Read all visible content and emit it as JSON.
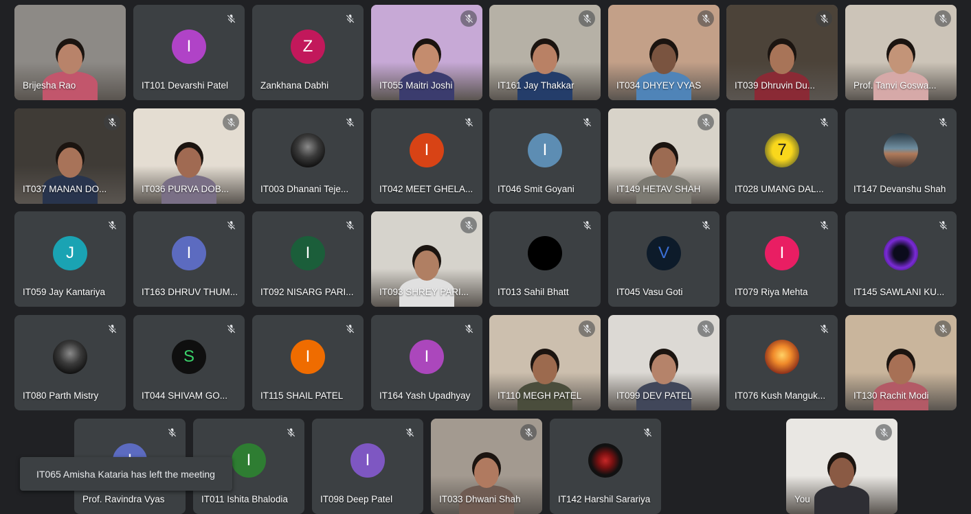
{
  "app": "Google Meet",
  "toast": "IT065 Amisha Kataria has left the meeting",
  "participants": [
    {
      "name": "Brijesha Rao",
      "type": "video",
      "mic_icon": false,
      "bg": "#8d8a86",
      "skin": "#b8836a",
      "shirt": "#c2566c"
    },
    {
      "name": "IT101 Devarshi Patel",
      "type": "avatar",
      "initial": "I",
      "color": "#b043c7"
    },
    {
      "name": "Zankhana Dabhi",
      "type": "avatar",
      "initial": "Z",
      "color": "#c2185b"
    },
    {
      "name": "IT055 Maitri Joshi",
      "type": "video",
      "bg": "#c7a9d6",
      "skin": "#c48c6e",
      "shirt": "#3b3c6e"
    },
    {
      "name": "IT161 Jay Thakkar",
      "type": "video",
      "bg": "#b6b1a6",
      "skin": "#b98165",
      "shirt": "#243d6a"
    },
    {
      "name": "IT034 DHYEY VYAS",
      "type": "video",
      "bg": "#c3a088",
      "skin": "#7a5440",
      "shirt": "#4f84b8"
    },
    {
      "name": "IT039 Dhruvin Du...",
      "type": "video",
      "bg": "#4c4339",
      "skin": "#a87458",
      "shirt": "#8a2a35"
    },
    {
      "name": "Prof. Tanvi Goswa...",
      "type": "video",
      "bg": "#ccc4b8",
      "skin": "#c39478",
      "shirt": "#d6a9a8"
    },
    {
      "name": "IT037 MANAN DO...",
      "type": "video",
      "bg": "#3f3b36",
      "skin": "#a87359",
      "shirt": "#28344d"
    },
    {
      "name": "IT036 PURVA DOB...",
      "type": "video",
      "bg": "#e4ddd2",
      "skin": "#a06a52",
      "shirt": "#7a6f86"
    },
    {
      "name": "IT003 Dhanani Teje...",
      "type": "avatar",
      "initial": "",
      "color": "#2e2e2e",
      "pic": "dark-portrait"
    },
    {
      "name": "IT042 MEET GHELA...",
      "type": "avatar",
      "initial": "I",
      "color": "#d84315"
    },
    {
      "name": "IT046 Smit Goyani",
      "type": "avatar",
      "initial": "I",
      "color": "#5d8db3"
    },
    {
      "name": "IT149 HETAV SHAH",
      "type": "video",
      "bg": "#d8d3c9",
      "skin": "#9c6b52",
      "shirt": "#7c7a72"
    },
    {
      "name": "IT028 UMANG DAL...",
      "type": "avatar",
      "initial": "7",
      "color": "#f4c20d",
      "text_color": "#1a1a1a",
      "pic": "jersey"
    },
    {
      "name": "IT147 Devanshu Shah",
      "type": "avatar",
      "initial": "",
      "color": "#6d7b82",
      "pic": "landscape"
    },
    {
      "name": "IT059 Jay Kantariya",
      "type": "avatar",
      "initial": "J",
      "color": "#1aa3b3"
    },
    {
      "name": "IT163 DHRUV THUM...",
      "type": "avatar",
      "initial": "I",
      "color": "#5c6bc0"
    },
    {
      "name": "IT092 NISARG PARI...",
      "type": "avatar",
      "initial": "I",
      "color": "#1b5e3a"
    },
    {
      "name": "IT093 SHREY PARI...",
      "type": "video",
      "bg": "#d6d3cc",
      "skin": "#b07f63",
      "shirt": "#e0e0e0"
    },
    {
      "name": "IT013 Sahil Bhatt",
      "type": "avatar",
      "initial": "",
      "color": "#000000"
    },
    {
      "name": "IT045 Vasu Goti",
      "type": "avatar",
      "initial": "V",
      "color": "#0d1b2a",
      "text_color": "#3b6fd6"
    },
    {
      "name": "IT079 Riya Mehta",
      "type": "avatar",
      "initial": "I",
      "color": "#e91e63"
    },
    {
      "name": "IT145 SAWLANI KU...",
      "type": "avatar",
      "initial": "",
      "color": "#3b1f5e",
      "pic": "neon"
    },
    {
      "name": "IT080 Parth Mistry",
      "type": "avatar",
      "initial": "",
      "color": "#1a1a1a",
      "pic": "dark-portrait"
    },
    {
      "name": "IT044 SHIVAM GO...",
      "type": "avatar",
      "initial": "S",
      "color": "#0f0f0f",
      "text_color": "#3ad36b"
    },
    {
      "name": "IT115 SHAIL PATEL",
      "type": "avatar",
      "initial": "I",
      "color": "#ef6c00"
    },
    {
      "name": "IT164 Yash Upadhyay",
      "type": "avatar",
      "initial": "I",
      "color": "#ab47bc"
    },
    {
      "name": "IT110 MEGH PATEL",
      "type": "video",
      "bg": "#ccbfae",
      "skin": "#9c6a4e",
      "shirt": "#4a4d3c"
    },
    {
      "name": "IT099 DEV PATEL",
      "type": "video",
      "bg": "#dcd9d4",
      "skin": "#b5836a",
      "shirt": "#41475a"
    },
    {
      "name": "IT076 Kush Manguk...",
      "type": "avatar",
      "initial": "",
      "color": "#e5752a",
      "pic": "sunset"
    },
    {
      "name": "IT130 Rachit Modi",
      "type": "video",
      "bg": "#c9b59c",
      "skin": "#a77055",
      "shirt": "#b35a66"
    },
    {
      "name": "Prof. Ravindra Vyas",
      "type": "avatar",
      "initial": "I",
      "color": "#5c6bc0"
    },
    {
      "name": "IT011 Ishita Bhalodia",
      "type": "avatar",
      "initial": "I",
      "color": "#2e7d32"
    },
    {
      "name": "IT098 Deep Patel",
      "type": "avatar",
      "initial": "I",
      "color": "#7e57c2"
    },
    {
      "name": "IT033 Dhwani Shah",
      "type": "video",
      "bg": "#a39a90",
      "skin": "#b07a60",
      "shirt": "#6f5b52"
    },
    {
      "name": "IT142 Harshil Sarariya",
      "type": "avatar",
      "initial": "",
      "color": "#111111",
      "pic": "ironman"
    },
    {
      "name": "You",
      "type": "video",
      "bg": "#e9e7e3",
      "skin": "#8a5a44",
      "shirt": "#2e2e34"
    }
  ]
}
